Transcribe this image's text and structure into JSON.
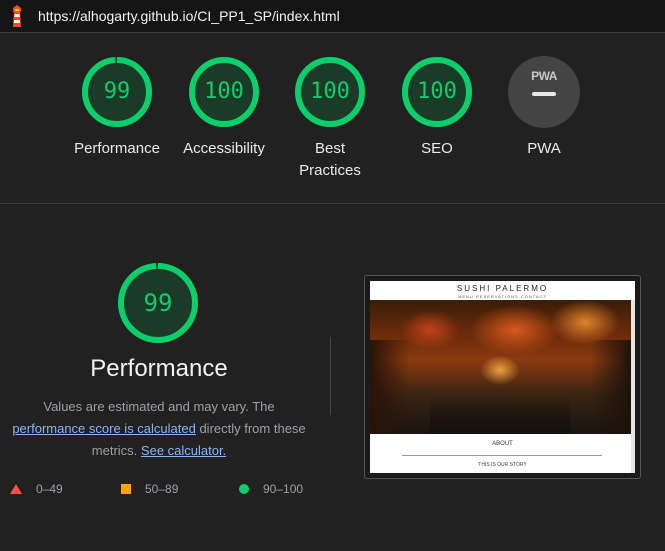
{
  "header": {
    "logo_icon": "lighthouse-icon",
    "url": "https://alhogarty.github.io/CI_PP1_SP/index.html"
  },
  "categories": [
    {
      "score": "99",
      "label": "Performance",
      "fraction": 0.99
    },
    {
      "score": "100",
      "label": "Accessibility",
      "fraction": 1.0
    },
    {
      "score": "100",
      "label": "Best Practices",
      "fraction": 1.0
    },
    {
      "score": "100",
      "label": "SEO",
      "fraction": 1.0
    },
    {
      "badge": "PWA",
      "label": "PWA"
    }
  ],
  "performance": {
    "score": "99",
    "fraction": 0.99,
    "title": "Performance",
    "desc_prefix": "Values are estimated and may vary. The ",
    "desc_link1": "performance score is calculated",
    "desc_middle": " directly from these metrics. ",
    "desc_link2": "See calculator."
  },
  "legend": [
    {
      "shape": "triangle",
      "range": "0–49",
      "color": "#ff4e42"
    },
    {
      "shape": "square",
      "range": "50–89",
      "color": "#ffa400"
    },
    {
      "shape": "circle",
      "range": "90–100",
      "color": "#0cce6b"
    }
  ],
  "screenshot": {
    "site_title": "SUSHI PALERMO",
    "site_subtitle": "MENU  RESERVATIONS  CONTACT",
    "about_label": "ABOUT",
    "story_label": "THIS IS OUR STORY"
  },
  "colors": {
    "pass": "#0cce6b",
    "average": "#ffa400",
    "fail": "#ff4e42",
    "background": "#212121"
  }
}
